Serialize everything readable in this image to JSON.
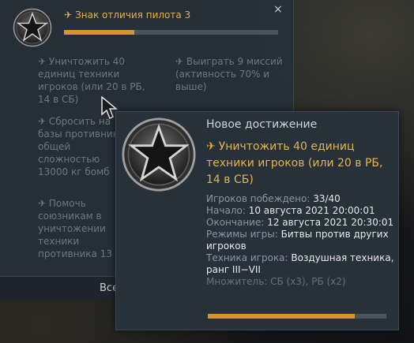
{
  "background_panel": {
    "title": "Знак отличия пилота 3",
    "close_label": "×",
    "progress_fraction": 0.33,
    "tasks": [
      {
        "icon": "wrench-icon",
        "text": "Уничтожить 40 единиц техники игроков (или 20 в РБ, 14 в СБ)"
      },
      {
        "icon": "wrench-icon",
        "text": "Выиграть 9 миссий (активность 70% и выше)"
      },
      {
        "icon": "wrench-icon",
        "text": "Сбросить на базы противника общей сложностью 13000 кг бомб"
      },
      {
        "icon": "wrench-icon",
        "text": "Помочь союзникам в уничтожении техники противника 13 раз"
      }
    ],
    "bottom_button": "Все"
  },
  "tooltip": {
    "heading": "Новое достижение",
    "title": "Уничтожить 40 единиц техники игроков (или 20 в РБ, 14 в СБ)",
    "rows": [
      {
        "label": "Игроков побеждено: ",
        "value": "33/40"
      },
      {
        "label": "Начало: ",
        "value": "10 августа 2021 20:00:01"
      },
      {
        "label": "Окончание: ",
        "value": "12 августа 2021 20:30:01"
      },
      {
        "label": "Режимы игры: ",
        "value": "Битвы против других игроков"
      },
      {
        "label": "Техника игрока: ",
        "value": "Воздушная техника, ранг III−VII"
      }
    ],
    "multiplier": "Множитель: СБ (x3), РБ (x2)",
    "progress_fraction": 0.825
  },
  "colors": {
    "accent_gold": "#e3b34a",
    "progress_orange": "#d9952c",
    "panel": "#27313a"
  }
}
